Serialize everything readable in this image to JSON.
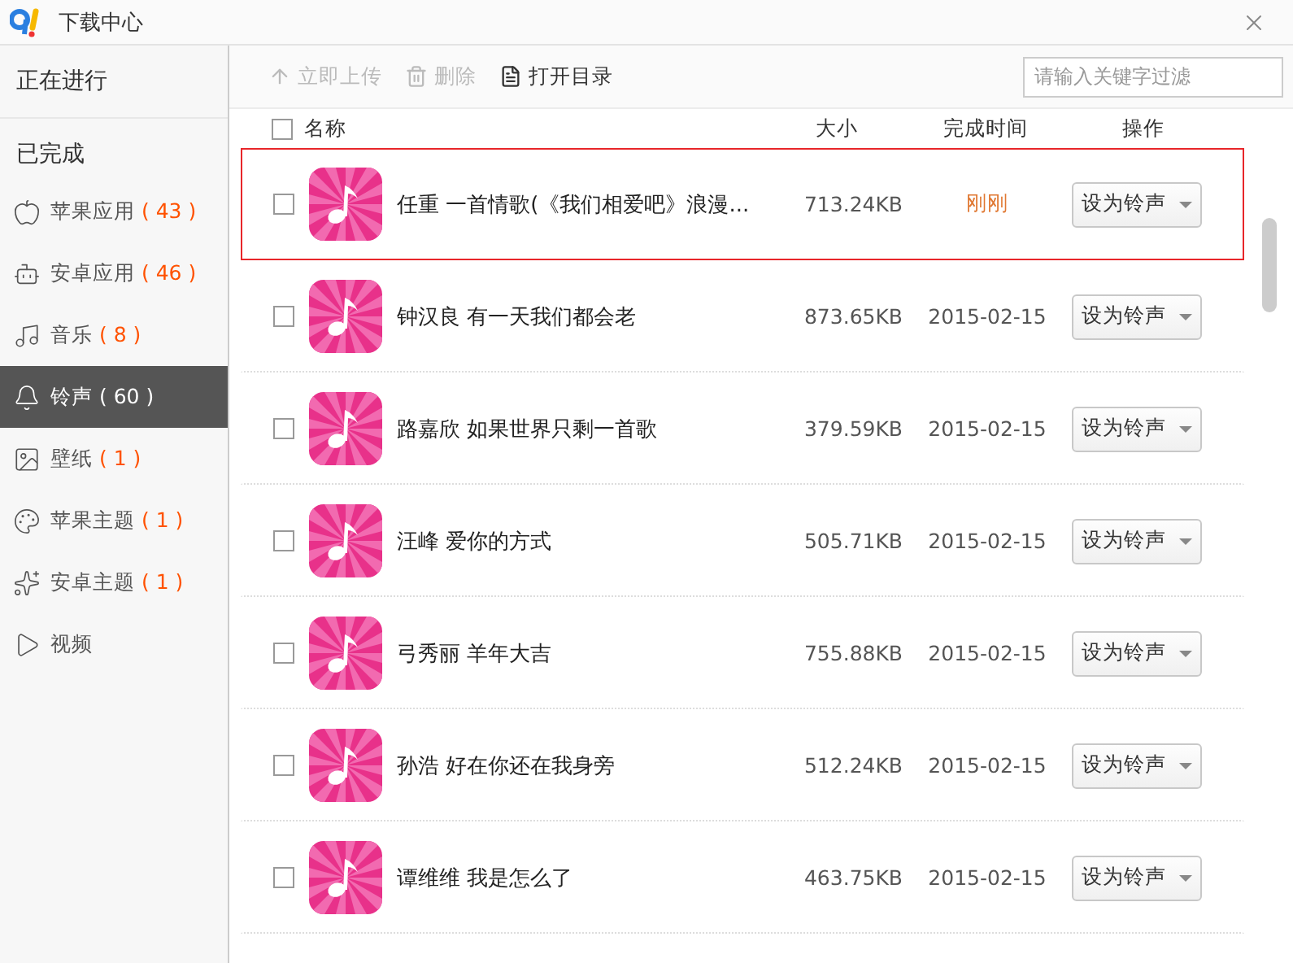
{
  "window": {
    "title": "下载中心"
  },
  "sidebar": {
    "sections": [
      {
        "label": "正在进行"
      },
      {
        "label": "已完成"
      }
    ],
    "items": [
      {
        "kind": "apple",
        "label": "苹果应用",
        "count": "( 43 )",
        "selected": false
      },
      {
        "kind": "android",
        "label": "安卓应用",
        "count": "( 46 )",
        "selected": false
      },
      {
        "kind": "music",
        "label": "音乐",
        "count": "( 8 )",
        "selected": false
      },
      {
        "kind": "ringtone",
        "label": "铃声",
        "count": "( 60 )",
        "selected": true
      },
      {
        "kind": "wallpaper",
        "label": "壁纸",
        "count": "( 1 )",
        "selected": false
      },
      {
        "kind": "theme",
        "label": "苹果主题",
        "count": "( 1 )",
        "selected": false
      },
      {
        "kind": "star",
        "label": "安卓主题",
        "count": "( 1 )",
        "selected": false
      },
      {
        "kind": "video",
        "label": "视频",
        "selected": false
      }
    ]
  },
  "toolbar": {
    "buttons": [
      {
        "kind": "upload",
        "label": "立即上传",
        "disabled": true
      },
      {
        "kind": "delete",
        "label": "删除",
        "disabled": true
      },
      {
        "kind": "folder",
        "label": "打开目录",
        "disabled": false
      }
    ],
    "search": {
      "placeholder": "请输入关键字过滤"
    }
  },
  "table": {
    "columns": [
      "名称",
      "大小",
      "完成时间",
      "操作"
    ],
    "select_all_checked": false,
    "rows": [
      {
        "name": "任重 一首情歌(《我们相爱吧》浪漫...",
        "size": "713.24KB",
        "time": "刚刚",
        "recent": true,
        "highlighted": true,
        "checked": false,
        "action": "设为铃声"
      },
      {
        "name": "钟汉良 有一天我们都会老",
        "size": "873.65KB",
        "time": "2015-02-15",
        "recent": false,
        "highlighted": false,
        "checked": false,
        "action": "设为铃声"
      },
      {
        "name": "路嘉欣 如果世界只剩一首歌",
        "size": "379.59KB",
        "time": "2015-02-15",
        "recent": false,
        "highlighted": false,
        "checked": false,
        "action": "设为铃声"
      },
      {
        "name": "汪峰 爱你的方式",
        "size": "505.71KB",
        "time": "2015-02-15",
        "recent": false,
        "highlighted": false,
        "checked": false,
        "action": "设为铃声"
      },
      {
        "name": "弓秀丽 羊年大吉",
        "size": "755.88KB",
        "time": "2015-02-15",
        "recent": false,
        "highlighted": false,
        "checked": false,
        "action": "设为铃声"
      },
      {
        "name": "孙浩 好在你还在我身旁",
        "size": "512.24KB",
        "time": "2015-02-15",
        "recent": false,
        "highlighted": false,
        "checked": false,
        "action": "设为铃声"
      },
      {
        "name": "谭维维 我是怎么了",
        "size": "463.75KB",
        "time": "2015-02-15",
        "recent": false,
        "highlighted": false,
        "checked": false,
        "action": "设为铃声"
      }
    ]
  }
}
